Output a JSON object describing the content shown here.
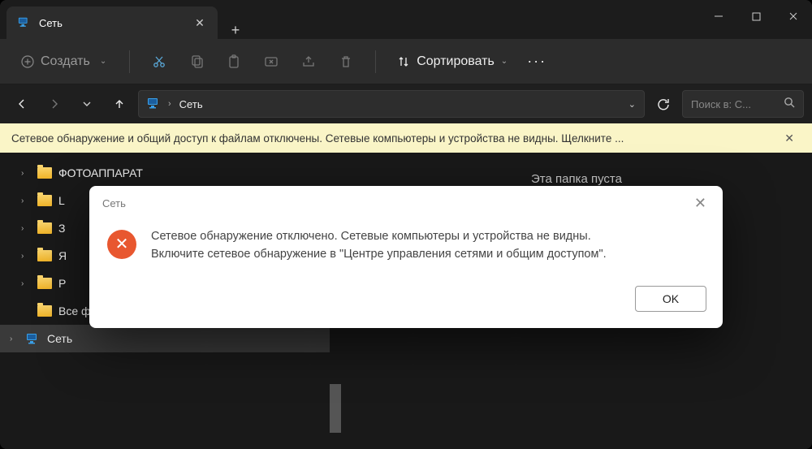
{
  "tab": {
    "title": "Сеть"
  },
  "toolbar": {
    "create": "Создать",
    "sort": "Сортировать"
  },
  "breadcrumb": {
    "location": "Сеть"
  },
  "search": {
    "placeholder": "Поиск в: С..."
  },
  "infobar": {
    "message": "Сетевое обнаружение и общий доступ к файлам отключены. Сетевые компьютеры и устройства не видны. Щелкните ..."
  },
  "tree": {
    "items": [
      {
        "label": "ФОТОАППАРАТ",
        "truncated": false
      },
      {
        "label": "L",
        "truncated": true
      },
      {
        "label": "З",
        "truncated": true
      },
      {
        "label": "Я",
        "truncated": true
      },
      {
        "label": "P",
        "truncated": true
      },
      {
        "label": "Все файлы с облака МАЙЛ РУ.zip",
        "truncated": false
      }
    ],
    "selected": "Сеть"
  },
  "main": {
    "empty": "Эта папка пуста"
  },
  "dialog": {
    "title": "Сеть",
    "message_line1": "Сетевое обнаружение отключено. Сетевые компьютеры и устройства не видны.",
    "message_line2": "Включите сетевое обнаружение в \"Центре управления сетями и общим доступом\".",
    "ok": "OK"
  }
}
